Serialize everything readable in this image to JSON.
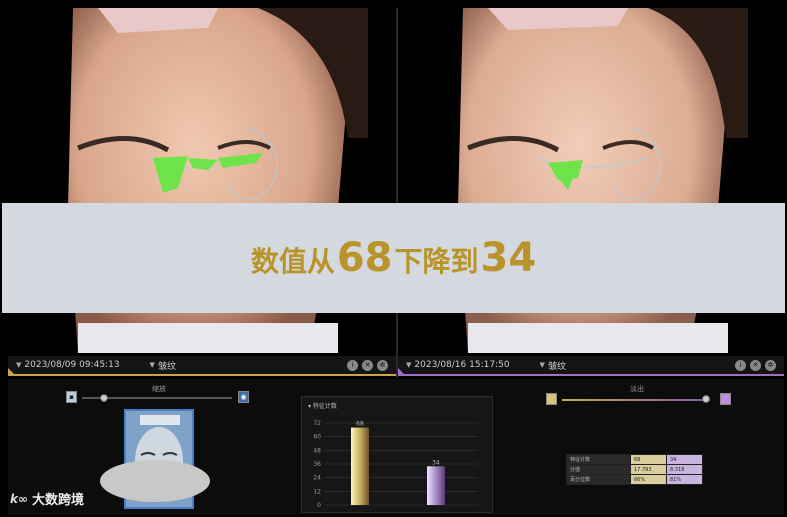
{
  "overlay": {
    "prefix": "数值从",
    "from_value": "68",
    "middle": "下降到",
    "to_value": "34"
  },
  "left_panel": {
    "date": "2023/08/09 09:45:13",
    "analysis_type": "皱纹",
    "accent_color": "#c8a640"
  },
  "right_panel": {
    "date": "2023/08/16 15:17:50",
    "analysis_type": "皱纹",
    "accent_color": "#a070c8"
  },
  "bottom": {
    "left_title": "缩放",
    "right_title": "淡出",
    "chart_title": "▾ 特征计数",
    "watermark": "大数跨境"
  },
  "chart_data": {
    "type": "bar",
    "title": "特征计数",
    "categories": [
      "2023/08/09",
      "2023/08/16"
    ],
    "values": [
      68,
      34
    ],
    "colors": [
      "#c9b060",
      "#a98cc8"
    ],
    "yticks": [
      0,
      12,
      24,
      36,
      48,
      60,
      72
    ],
    "ylim": [
      0,
      72
    ],
    "grid": true
  },
  "table": {
    "rows": [
      {
        "label": "特征计数",
        "v1": "68",
        "v2": "34"
      },
      {
        "label": "分值",
        "v1": "17.793",
        "v2": "8.318"
      },
      {
        "label": "百分位数",
        "v1": "66%",
        "v2": "81%"
      }
    ]
  },
  "icons": {
    "tools": [
      "info-icon",
      "close-icon",
      "settings-icon"
    ]
  }
}
